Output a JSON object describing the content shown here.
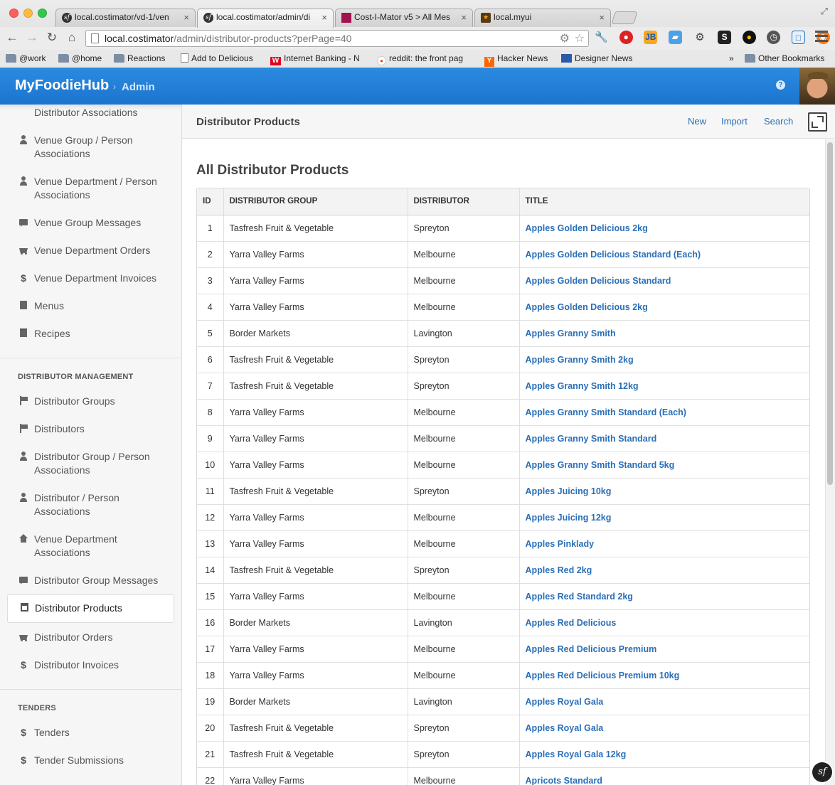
{
  "browser": {
    "tabs": [
      {
        "title": "local.costimator/vd-1/ven",
        "favicon": "sf",
        "active": false
      },
      {
        "title": "local.costimator/admin/di",
        "favicon": "sf",
        "active": true
      },
      {
        "title": "Cost-I-Mator v5 > All Mes",
        "favicon": "pink",
        "active": false
      },
      {
        "title": "local.myui",
        "favicon": "star",
        "active": false
      }
    ],
    "url_host": "local.costimator",
    "url_path": "/admin/distributor-products?perPage=40",
    "bookmarks": [
      {
        "label": "@work",
        "icon": "folder"
      },
      {
        "label": "@home",
        "icon": "folder"
      },
      {
        "label": "Reactions",
        "icon": "folder"
      },
      {
        "label": "Add to Delicious",
        "icon": "page"
      },
      {
        "label": "Internet Banking - N",
        "icon": "westpac"
      },
      {
        "label": "reddit: the front pag",
        "icon": "reddit"
      },
      {
        "label": "Hacker News",
        "icon": "hn"
      },
      {
        "label": "Designer News",
        "icon": "dn"
      }
    ],
    "bookmarks_overflow": "»",
    "other_bookmarks": "Other Bookmarks"
  },
  "header": {
    "brand": "MyFoodieHub",
    "crumb_sep": "›",
    "crumb": "Admin",
    "help": "?"
  },
  "sidebar": {
    "top_items": [
      {
        "label": "Distributor Associations",
        "icon": "none"
      },
      {
        "label": "Venue Group / Person Associations",
        "icon": "person"
      },
      {
        "label": "Venue Department / Person Associations",
        "icon": "person"
      },
      {
        "label": "Venue Group Messages",
        "icon": "chat"
      },
      {
        "label": "Venue Department Orders",
        "icon": "cart"
      },
      {
        "label": "Venue Department Invoices",
        "icon": "dollar"
      },
      {
        "label": "Menus",
        "icon": "book"
      },
      {
        "label": "Recipes",
        "icon": "doc"
      }
    ],
    "section_distributor": "DISTRIBUTOR MANAGEMENT",
    "distributor_items": [
      {
        "label": "Distributor Groups",
        "icon": "flag"
      },
      {
        "label": "Distributors",
        "icon": "flag"
      },
      {
        "label": "Distributor Group / Person Associations",
        "icon": "person"
      },
      {
        "label": "Distributor / Person Associations",
        "icon": "person"
      },
      {
        "label": "Venue Department Associations",
        "icon": "home"
      },
      {
        "label": "Distributor Group Messages",
        "icon": "chat"
      },
      {
        "label": "Distributor Products",
        "icon": "list",
        "active": true
      },
      {
        "label": "Distributor Orders",
        "icon": "cart"
      },
      {
        "label": "Distributor Invoices",
        "icon": "dollar"
      }
    ],
    "section_tenders": "TENDERS",
    "tender_items": [
      {
        "label": "Tenders",
        "icon": "dollar"
      },
      {
        "label": "Tender Submissions",
        "icon": "dollar"
      }
    ]
  },
  "main": {
    "title": "Distributor Products",
    "actions": {
      "new": "New",
      "import": "Import",
      "search": "Search"
    },
    "section_title": "All Distributor Products",
    "table": {
      "columns": [
        "ID",
        "DISTRIBUTOR GROUP",
        "DISTRIBUTOR",
        "TITLE"
      ],
      "rows": [
        [
          "1",
          "Tasfresh Fruit & Vegetable",
          "Spreyton",
          "Apples Golden Delicious 2kg"
        ],
        [
          "2",
          "Yarra Valley Farms",
          "Melbourne",
          "Apples Golden Delicious Standard (Each)"
        ],
        [
          "3",
          "Yarra Valley Farms",
          "Melbourne",
          "Apples Golden Delicious Standard"
        ],
        [
          "4",
          "Yarra Valley Farms",
          "Melbourne",
          "Apples Golden Delicious 2kg"
        ],
        [
          "5",
          "Border Markets",
          "Lavington",
          "Apples Granny Smith"
        ],
        [
          "6",
          "Tasfresh Fruit & Vegetable",
          "Spreyton",
          "Apples Granny Smith 2kg"
        ],
        [
          "7",
          "Tasfresh Fruit & Vegetable",
          "Spreyton",
          "Apples Granny Smith 12kg"
        ],
        [
          "8",
          "Yarra Valley Farms",
          "Melbourne",
          "Apples Granny Smith Standard (Each)"
        ],
        [
          "9",
          "Yarra Valley Farms",
          "Melbourne",
          "Apples Granny Smith Standard"
        ],
        [
          "10",
          "Yarra Valley Farms",
          "Melbourne",
          "Apples Granny Smith Standard 5kg"
        ],
        [
          "11",
          "Tasfresh Fruit & Vegetable",
          "Spreyton",
          "Apples Juicing 10kg"
        ],
        [
          "12",
          "Yarra Valley Farms",
          "Melbourne",
          "Apples Juicing 12kg"
        ],
        [
          "13",
          "Yarra Valley Farms",
          "Melbourne",
          "Apples Pinklady"
        ],
        [
          "14",
          "Tasfresh Fruit & Vegetable",
          "Spreyton",
          "Apples Red 2kg"
        ],
        [
          "15",
          "Yarra Valley Farms",
          "Melbourne",
          "Apples Red Standard 2kg"
        ],
        [
          "16",
          "Border Markets",
          "Lavington",
          "Apples Red Delicious"
        ],
        [
          "17",
          "Yarra Valley Farms",
          "Melbourne",
          "Apples Red Delicious Premium"
        ],
        [
          "18",
          "Yarra Valley Farms",
          "Melbourne",
          "Apples Red Delicious Premium 10kg"
        ],
        [
          "19",
          "Border Markets",
          "Lavington",
          "Apples Royal Gala"
        ],
        [
          "20",
          "Tasfresh Fruit & Vegetable",
          "Spreyton",
          "Apples Royal Gala"
        ],
        [
          "21",
          "Tasfresh Fruit & Vegetable",
          "Spreyton",
          "Apples Royal Gala 12kg"
        ],
        [
          "22",
          "Yarra Valley Farms",
          "Melbourne",
          "Apricots Standard"
        ]
      ]
    }
  },
  "colors": {
    "header_blue": "#1b74ce",
    "link_blue": "#2a6fb8"
  }
}
